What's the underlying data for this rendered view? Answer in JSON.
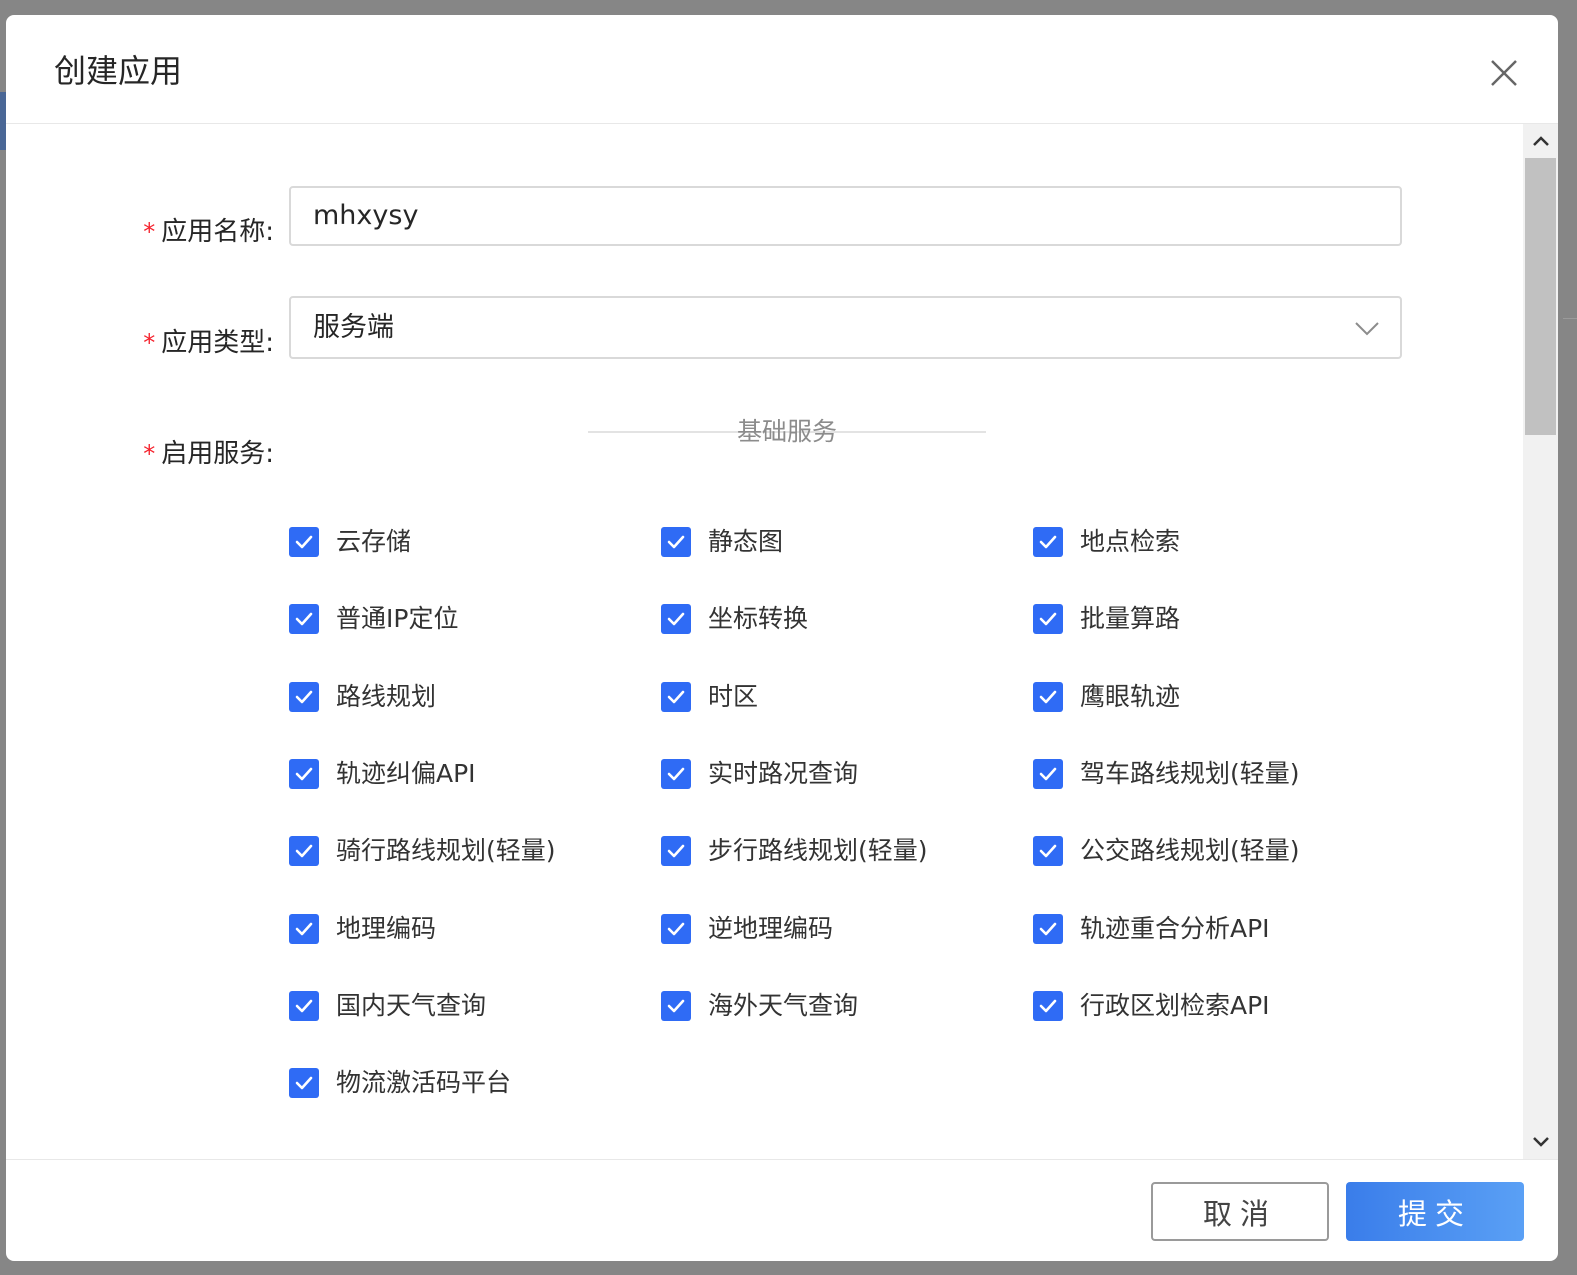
{
  "dialog": {
    "title": "创建应用"
  },
  "form": {
    "name_label": "应用名称:",
    "name_value": "mhxysy",
    "type_label": "应用类型:",
    "type_value": "服务端",
    "services_label": "启用服务:",
    "required_mark": "*"
  },
  "services": {
    "section_title": "基础服务",
    "items": [
      {
        "label": "云存储",
        "checked": true
      },
      {
        "label": "静态图",
        "checked": true
      },
      {
        "label": "地点检索",
        "checked": true
      },
      {
        "label": "普通IP定位",
        "checked": true
      },
      {
        "label": "坐标转换",
        "checked": true
      },
      {
        "label": "批量算路",
        "checked": true
      },
      {
        "label": "路线规划",
        "checked": true
      },
      {
        "label": "时区",
        "checked": true
      },
      {
        "label": "鹰眼轨迹",
        "checked": true
      },
      {
        "label": "轨迹纠偏API",
        "checked": true
      },
      {
        "label": "实时路况查询",
        "checked": true
      },
      {
        "label": "驾车路线规划(轻量)",
        "checked": true
      },
      {
        "label": "骑行路线规划(轻量)",
        "checked": true
      },
      {
        "label": "步行路线规划(轻量)",
        "checked": true
      },
      {
        "label": "公交路线规划(轻量)",
        "checked": true
      },
      {
        "label": "地理编码",
        "checked": true
      },
      {
        "label": "逆地理编码",
        "checked": true
      },
      {
        "label": "轨迹重合分析API",
        "checked": true
      },
      {
        "label": "国内天气查询",
        "checked": true
      },
      {
        "label": "海外天气查询",
        "checked": true
      },
      {
        "label": "行政区划检索API",
        "checked": true
      },
      {
        "label": "物流激活码平台",
        "checked": true
      }
    ]
  },
  "footer": {
    "cancel_label": "取消",
    "submit_label": "提交"
  },
  "colors": {
    "checkbox": "#2f6bf5",
    "required": "#f5222d",
    "submit_start": "#3a7dea",
    "submit_end": "#5aa0f5"
  }
}
